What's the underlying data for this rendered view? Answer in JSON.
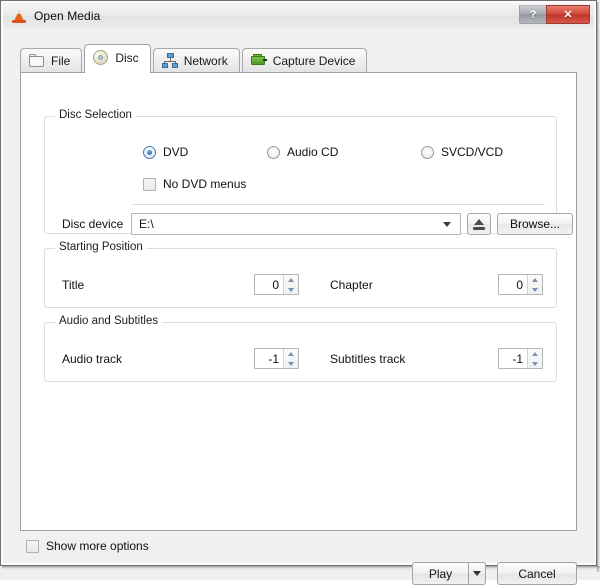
{
  "window": {
    "title": "Open Media",
    "app_icon": "vlc-cone-icon",
    "help_label": "?",
    "close_label": "✕"
  },
  "tabs": [
    {
      "label": "File",
      "icon": "folder-icon",
      "active": false
    },
    {
      "label": "Disc",
      "icon": "disc-icon",
      "active": true
    },
    {
      "label": "Network",
      "icon": "network-icon",
      "active": false
    },
    {
      "label": "Capture Device",
      "icon": "capture-card-icon",
      "active": false
    }
  ],
  "disc_selection": {
    "title": "Disc Selection",
    "radios": [
      {
        "label": "DVD",
        "checked": true
      },
      {
        "label": "Audio CD",
        "checked": false
      },
      {
        "label": "SVCD/VCD",
        "checked": false
      }
    ],
    "no_dvd_menus": {
      "label": "No DVD menus",
      "checked": false
    },
    "device_label": "Disc device",
    "device_value": "E:\\",
    "eject_icon": "eject-icon",
    "browse_label": "Browse..."
  },
  "starting_position": {
    "title": "Starting Position",
    "title_label": "Title",
    "title_value": "0",
    "chapter_label": "Chapter",
    "chapter_value": "0"
  },
  "audio_and_subtitles": {
    "title": "Audio and Subtitles",
    "audio_label": "Audio track",
    "audio_value": "-1",
    "subtitles_label": "Subtitles track",
    "subtitles_value": "-1"
  },
  "footer": {
    "show_more": {
      "label": "Show more options",
      "checked": false
    },
    "play_label": "Play",
    "play_menu_icon": "chevron-down-icon",
    "cancel_label": "Cancel"
  },
  "colors": {
    "accent_blue": "#2b7fc4",
    "close_red": "#d4483a",
    "panel_bg": "#ffffff",
    "dialog_bg": "#f0f0f0"
  }
}
